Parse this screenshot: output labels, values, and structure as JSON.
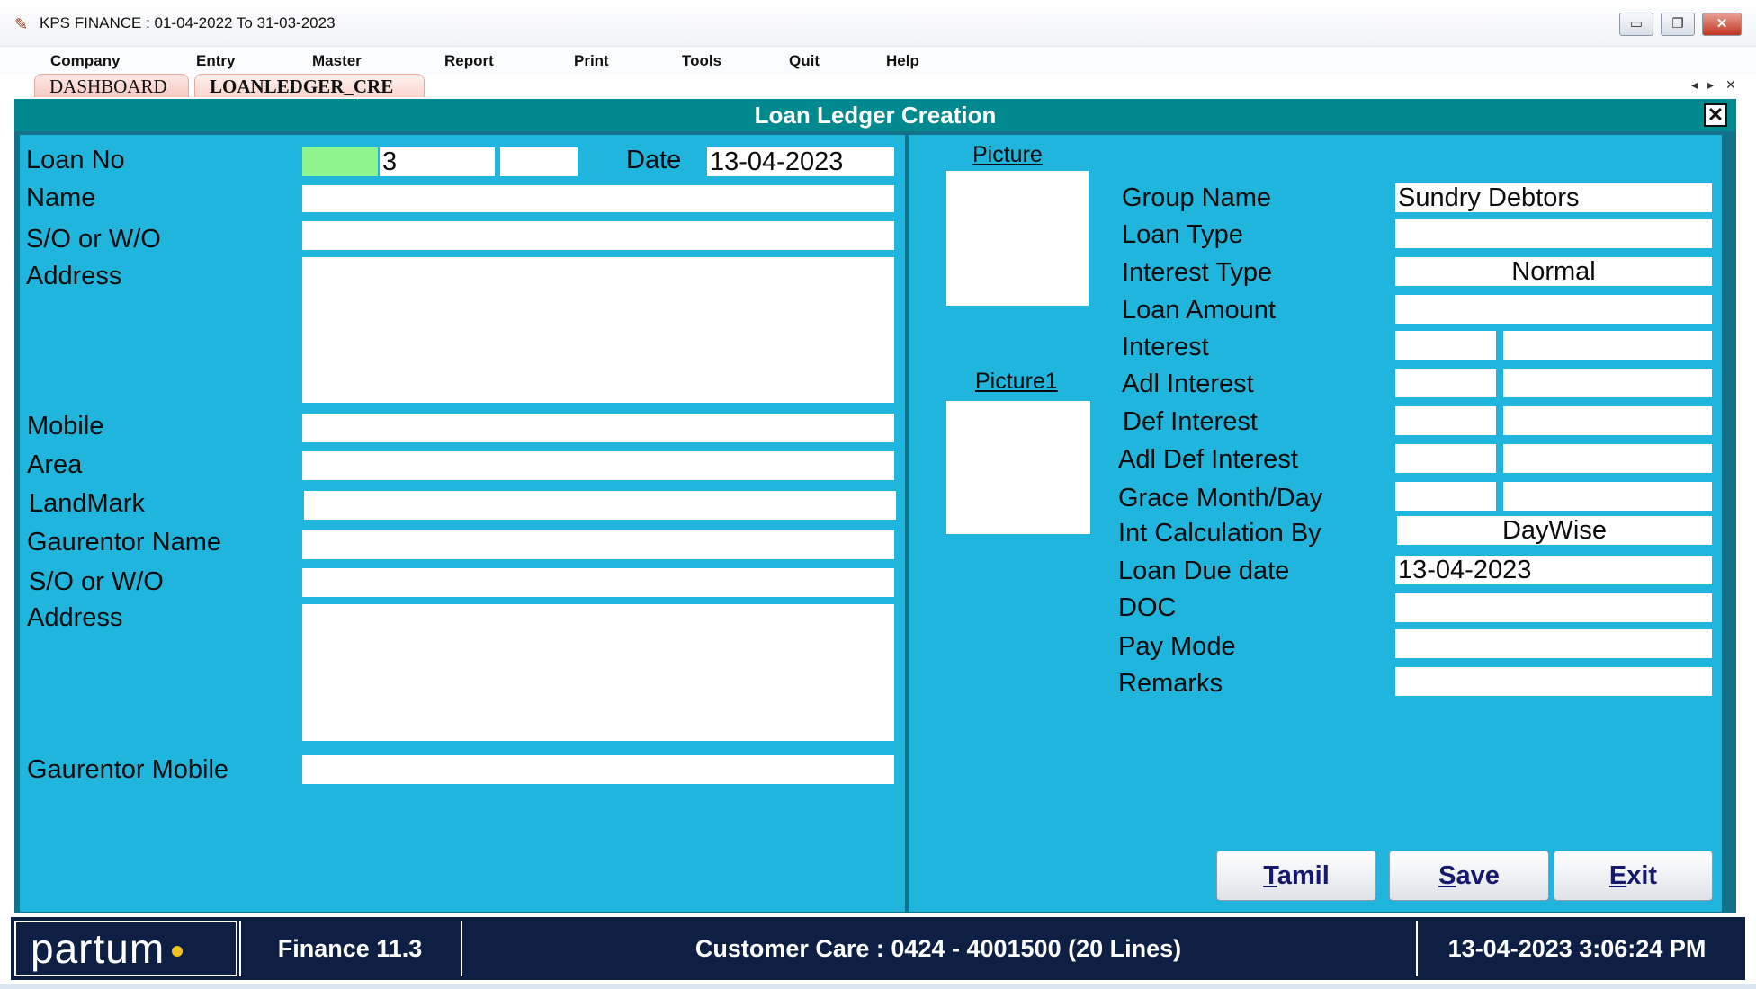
{
  "window": {
    "title": "KPS FINANCE  :  01-04-2022 To 31-03-2023",
    "app_icon_name": "kps-app-icon",
    "minimize_glyph": "▭",
    "restore_glyph": "❐",
    "close_glyph": "✕"
  },
  "menu": {
    "items": [
      {
        "label": "Company"
      },
      {
        "label": "Entry"
      },
      {
        "label": "Master"
      },
      {
        "label": "Report"
      },
      {
        "label": "Print"
      },
      {
        "label": "Tools"
      },
      {
        "label": "Quit"
      },
      {
        "label": "Help"
      }
    ]
  },
  "tabs": {
    "items": [
      {
        "label": "DASHBOARD",
        "active": false
      },
      {
        "label": "LOANLEDGER_CRE",
        "active": true
      }
    ],
    "nav_left": "◂",
    "nav_right": "▸",
    "nav_close": "✕"
  },
  "form": {
    "title": "Loan Ledger Creation",
    "close_glyph": "✕",
    "left": {
      "loan_no_label": "Loan No",
      "loan_no_prefix": "",
      "loan_no_value": "3",
      "loan_no_suffix": "",
      "date_label": "Date",
      "date_value": "13-04-2023",
      "name_label": "Name",
      "name_value": "",
      "so_wo_label": "S/O or W/O",
      "so_wo_value": "",
      "address_label": "Address",
      "address_value": "",
      "mobile_label": "Mobile",
      "mobile_value": "",
      "area_label": "Area",
      "area_value": "",
      "landmark_label": "LandMark",
      "landmark_value": "",
      "gaurentor_name_label": "Gaurentor Name",
      "gaurentor_name_value": "",
      "g_so_wo_label": "S/O or W/O",
      "g_so_wo_value": "",
      "g_address_label": "Address",
      "g_address_value": "",
      "gaurentor_mobile_label": "Gaurentor Mobile",
      "gaurentor_mobile_value": ""
    },
    "right": {
      "picture_label": "Picture",
      "picture1_label": "Picture1",
      "group_name_label": "Group Name",
      "group_name_value": "Sundry Debtors",
      "loan_type_label": "Loan Type",
      "loan_type_value": "",
      "interest_type_label": "Interest Type",
      "interest_type_value": "Normal",
      "loan_amount_label": "Loan Amount",
      "loan_amount_value": "",
      "interest_label": "Interest",
      "adl_interest_label": "Adl Interest",
      "def_interest_label": "Def Interest",
      "adl_def_interest_label": "Adl Def Interest",
      "grace_label": "Grace Month/Day",
      "int_calc_label": "Int Calculation By",
      "int_calc_value": "DayWise",
      "due_date_label": "Loan Due date",
      "due_date_value": "13-04-2023",
      "doc_label": "DOC",
      "doc_value": "",
      "pay_mode_label": "Pay Mode",
      "pay_mode_value": "",
      "remarks_label": "Remarks",
      "remarks_value": ""
    },
    "buttons": {
      "tamil_first": "T",
      "tamil_rest": "amil",
      "save_first": "S",
      "save_rest": "ave",
      "exit_first": "E",
      "exit_rest": "xit"
    }
  },
  "status": {
    "logo_text": "partum",
    "version": "Finance 11.3",
    "customer_care": "Customer Care : 0424 - 4001500  (20 Lines)",
    "datetime": "13-04-2023 3:06:24 PM"
  },
  "colors": {
    "panel_header": "#00898f",
    "form_bg": "#1fb5dc",
    "status_bg": "#0d1f43",
    "loan_no_highlight": "#8ef58e",
    "button_text": "#17186f"
  }
}
